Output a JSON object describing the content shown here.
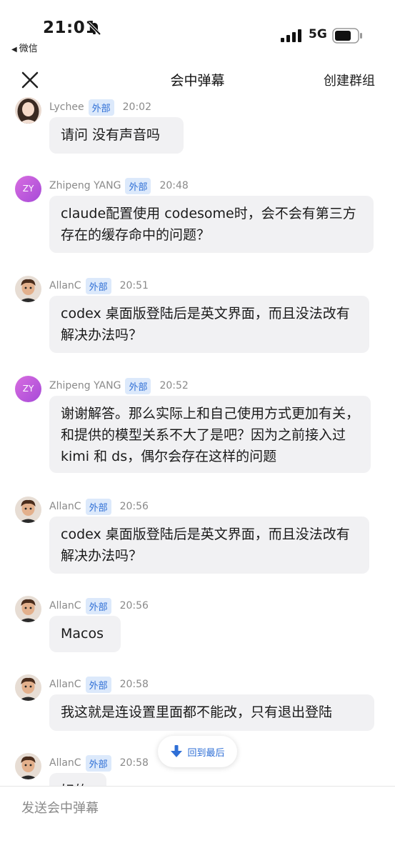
{
  "status_bar": {
    "time": "21:01",
    "back_app": "微信",
    "network": "5G"
  },
  "nav": {
    "title": "会中弹幕",
    "create_group": "创建群组"
  },
  "tag_external": "外部",
  "messages": [
    {
      "user": "Lychee",
      "time": "20:02",
      "text": "请问 没有声音吗",
      "avatar": "photo-woman"
    },
    {
      "user": "Zhipeng YANG",
      "time": "20:48",
      "text": "claude配置使用 codesome时，会不会有第三方存在的缓存命中的问题？",
      "avatar": "ZY"
    },
    {
      "user": "AllanC",
      "time": "20:51",
      "text": "codex 桌面版登陆后是英文界面，而且没法改有解决办法吗？",
      "avatar": "cartoon-man"
    },
    {
      "user": "Zhipeng YANG",
      "time": "20:52",
      "text": "谢谢解答。那么实际上和自己使用方式更加有关，和提供的模型关系不大了是吧？因为之前接入过 kimi 和 ds，偶尔会存在这样的问题",
      "avatar": "ZY"
    },
    {
      "user": "AllanC",
      "time": "20:56",
      "text": "codex 桌面版登陆后是英文界面，而且没法改有解决办法吗？",
      "avatar": "cartoon-man"
    },
    {
      "user": "AllanC",
      "time": "20:56",
      "text": "Macos",
      "avatar": "cartoon-man"
    },
    {
      "user": "AllanC",
      "time": "20:58",
      "text": "我这就是连设置里面都不能改，只有退出登陆",
      "avatar": "cartoon-man"
    },
    {
      "user": "AllanC",
      "time": "20:58",
      "text": "好的",
      "avatar": "cartoon-man"
    }
  ],
  "jump_to_latest": "回到最后",
  "input": {
    "placeholder": "发送会中弹幕"
  }
}
